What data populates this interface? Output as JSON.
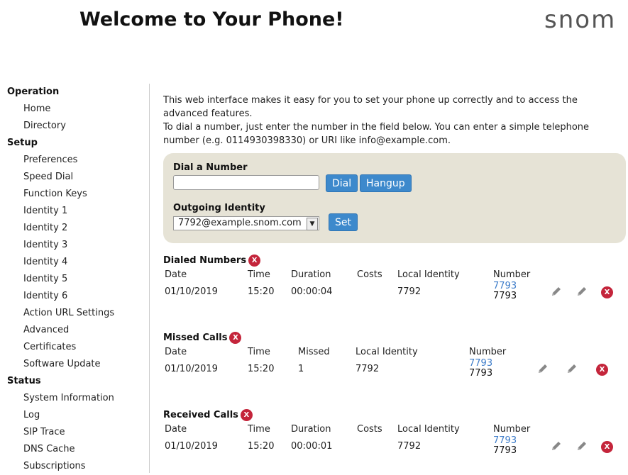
{
  "header": {
    "title": "Welcome to Your Phone!",
    "logo": "snom"
  },
  "sidebar": {
    "sections": [
      {
        "heading": "Operation",
        "items": [
          "Home",
          "Directory"
        ]
      },
      {
        "heading": "Setup",
        "items": [
          "Preferences",
          "Speed Dial",
          "Function Keys",
          "Identity 1",
          "Identity 2",
          "Identity 3",
          "Identity 4",
          "Identity 5",
          "Identity 6",
          "Action URL Settings",
          "Advanced",
          "Certificates",
          "Software Update"
        ]
      },
      {
        "heading": "Status",
        "items": [
          "System Information",
          "Log",
          "SIP Trace",
          "DNS Cache",
          "Subscriptions"
        ]
      }
    ]
  },
  "intro": {
    "line1": "This web interface makes it easy for you to set your phone up correctly and to access the",
    "line2": "advanced features.",
    "line3": "To dial a number, just enter the number in the field below. You can enter a simple telephone",
    "line4": "number (e.g. 0114930398330) or URI like info@example.com."
  },
  "dial": {
    "label": "Dial a Number",
    "input_value": "",
    "dial_button": "Dial",
    "hangup_button": "Hangup",
    "identity_label": "Outgoing Identity",
    "identity_value": "7792@example.snom.com",
    "set_button": "Set"
  },
  "dialed": {
    "title": "Dialed Numbers",
    "headers": [
      "Date",
      "Time",
      "Duration",
      "Costs",
      "Local Identity",
      "Number"
    ],
    "row": {
      "date": "01/10/2019",
      "time": "15:20",
      "duration": "00:00:04",
      "costs": "",
      "local": "7792",
      "number_link": "7793",
      "number": "7793"
    }
  },
  "missed": {
    "title": "Missed Calls",
    "headers": [
      "Date",
      "Time",
      "Missed",
      "Local Identity",
      "Number"
    ],
    "row": {
      "date": "01/10/2019",
      "time": "15:20",
      "missed": "1",
      "local": "7792",
      "number_link": "7793",
      "number": "7793"
    }
  },
  "received": {
    "title": "Received Calls",
    "headers": [
      "Date",
      "Time",
      "Duration",
      "Costs",
      "Local Identity",
      "Number"
    ],
    "row": {
      "date": "01/10/2019",
      "time": "15:20",
      "duration": "00:00:01",
      "costs": "",
      "local": "7792",
      "number_link": "7793",
      "number": "7793"
    }
  },
  "icons": {
    "delete": "X",
    "edit": "pencil-icon"
  },
  "colors": {
    "accent": "#3d89cc",
    "delete": "#c4253b",
    "panel": "#e6e3d6",
    "link": "#3d7cc9"
  }
}
